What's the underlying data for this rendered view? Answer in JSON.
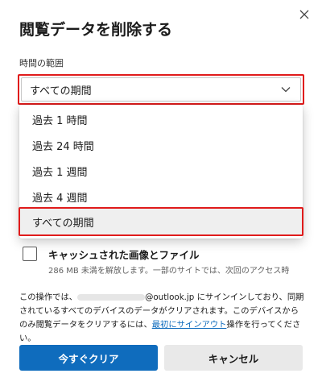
{
  "dialog": {
    "title": "閲覧データを削除する",
    "time_range_label": "時間の範囲",
    "selected_range": "すべての期間",
    "range_options": [
      "過去 1 時間",
      "過去 24 時間",
      "過去 1 週間",
      "過去 4 週間",
      "すべての期間"
    ],
    "cache_title": "キャッシュされた画像とファイル",
    "cache_desc": "286 MB 未満を解放します。一部のサイトでは、次回のアクセス時",
    "cache_checked": false,
    "info_prefix": "この操作では、",
    "info_email_domain": "@outlook.jp",
    "info_middle": " にサインインしており、同期されているすべてのデバイスのデータがクリアされます。このデバイスからのみ閲覧データをクリアするには、",
    "info_link": "最初にサインアウト",
    "info_suffix": "操作を行ってください。",
    "clear_now": "今すぐクリア",
    "cancel": "キャンセル"
  },
  "colors": {
    "accent": "#0f6cbd",
    "highlight": "#e01b1b",
    "selected_bg": "#efefef"
  },
  "icons": {
    "close": "close-icon",
    "dropdown": "chevron-down-icon"
  }
}
